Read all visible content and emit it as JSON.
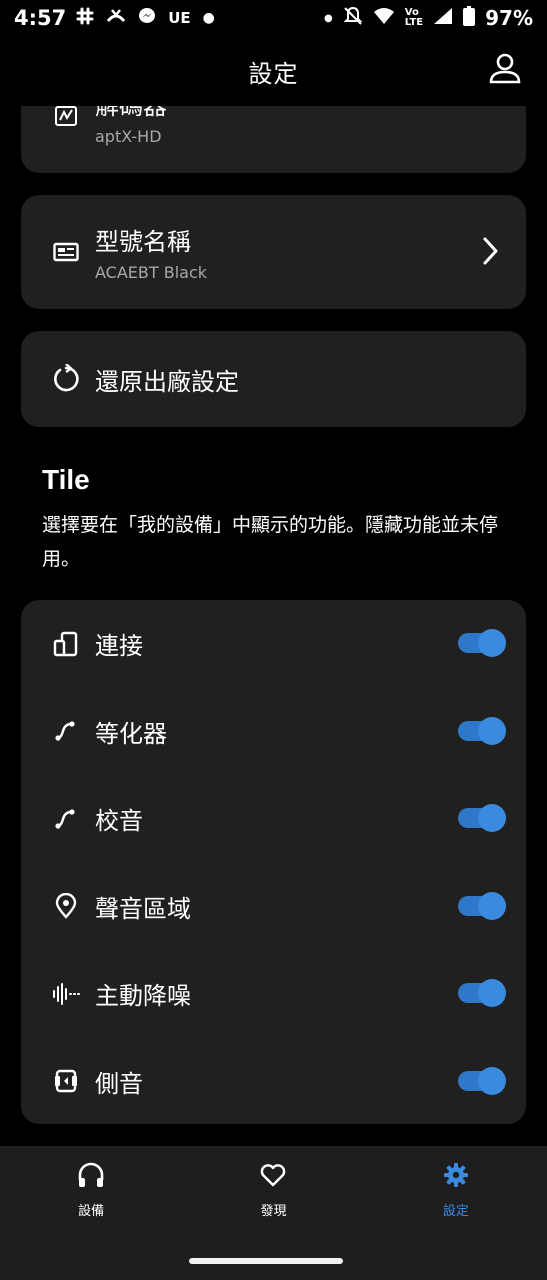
{
  "status_bar": {
    "time": "4:57",
    "left_icons": [
      "slack-icon",
      "call-forward-icon",
      "messenger-icon",
      "ue-icon",
      "dot-icon"
    ],
    "ue_text": "UE",
    "right_icons": [
      "dot-icon",
      "mute-icon",
      "wifi-icon",
      "volte-icon",
      "signal-icon",
      "battery-icon"
    ],
    "battery": "97%"
  },
  "app_bar": {
    "title": "設定",
    "account_icon": "account-icon"
  },
  "codec": {
    "label": "解碼器",
    "value": "aptX-HD",
    "icon": "codec-icon"
  },
  "model": {
    "label": "型號名稱",
    "value": "ACAEBT Black",
    "icon": "id-card-icon"
  },
  "reset": {
    "label": "還原出廠設定",
    "icon": "reset-icon"
  },
  "tiles_section": {
    "title": "Tile",
    "description": "選擇要在「我的設備」中顯示的功能。隱藏功能並未停用。",
    "items": [
      {
        "label": "連接",
        "icon": "devices-icon",
        "enabled": true
      },
      {
        "label": "等化器",
        "icon": "curve-icon",
        "enabled": true
      },
      {
        "label": "校音",
        "icon": "curve-icon",
        "enabled": true
      },
      {
        "label": "聲音區域",
        "icon": "location-pin-icon",
        "enabled": true
      },
      {
        "label": "主動降噪",
        "icon": "noise-cancel-icon",
        "enabled": true
      },
      {
        "label": "側音",
        "icon": "sidetone-icon",
        "enabled": true
      }
    ]
  },
  "bottom_nav": {
    "items": [
      {
        "label": "設備",
        "icon": "headphones-icon",
        "active": false
      },
      {
        "label": "發現",
        "icon": "heart-icon",
        "active": false
      },
      {
        "label": "設定",
        "icon": "gear-icon",
        "active": true
      }
    ]
  },
  "colors": {
    "background": "#000000",
    "card": "#202020",
    "accent": "#3a8ae0",
    "nav_bar": "#1e1e1e",
    "secondary_text": "#a8a8a8"
  }
}
